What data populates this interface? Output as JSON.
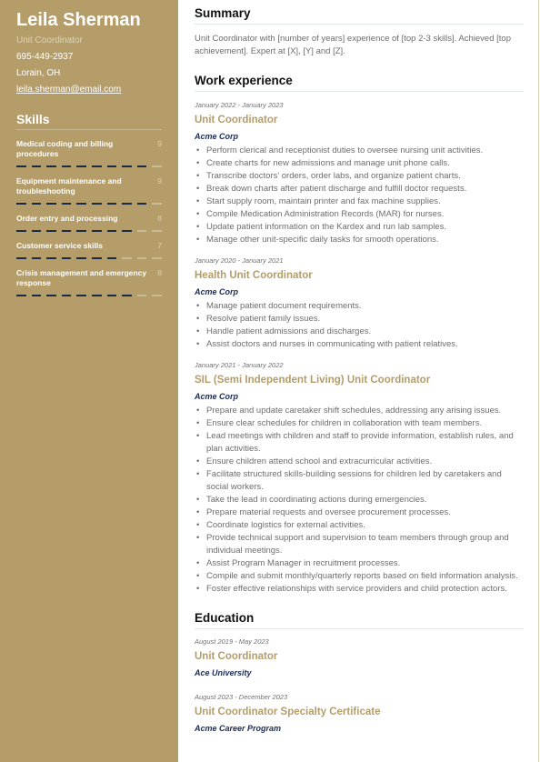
{
  "sidebar": {
    "name": "Leila Sherman",
    "title": "Unit Coordinator",
    "phone": "695-449-2937",
    "location": "Lorain, OH",
    "email": "leila.sherman@email.com",
    "skills_title": "Skills",
    "skills": [
      {
        "name": "Medical coding and billing procedures",
        "score": "9",
        "level": 9,
        "max": 10
      },
      {
        "name": "Equipment maintenance and troubleshooting",
        "score": "9",
        "level": 9,
        "max": 10
      },
      {
        "name": "Order entry and processing",
        "score": "8",
        "level": 8,
        "max": 10
      },
      {
        "name": "Customer service skills",
        "score": "7",
        "level": 7,
        "max": 10
      },
      {
        "name": "Crisis management and emergency response",
        "score": "8",
        "level": 8,
        "max": 10
      }
    ]
  },
  "summary": {
    "title": "Summary",
    "text": "Unit Coordinator with [number of years] experience of [top 2-3 skills]. Achieved [top achievement]. Expert at [X], [Y] and [Z]."
  },
  "experience": {
    "title": "Work experience",
    "jobs": [
      {
        "dates": "January 2022 - January 2023",
        "role": "Unit Coordinator",
        "company": "Acme Corp",
        "bullets": [
          "Perform clerical and receptionist duties to oversee nursing unit activities.",
          "Create charts for new admissions and manage unit phone calls.",
          "Transcribe doctors' orders, order labs, and organize patient charts.",
          "Break down charts after patient discharge and fulfill doctor requests.",
          "Start supply room, maintain printer and fax machine supplies.",
          "Compile Medication Administration Records (MAR) for nurses.",
          "Update patient information on the Kardex and run lab samples.",
          "Manage other unit-specific daily tasks for smooth operations."
        ]
      },
      {
        "dates": "January 2020 - January 2021",
        "role": "Health Unit Coordinator",
        "company": "Acme Corp",
        "bullets": [
          "Manage patient document requirements.",
          "Resolve patient family issues.",
          "Handle patient admissions and discharges.",
          "Assist doctors and nurses in communicating with patient relatives."
        ]
      },
      {
        "dates": "January 2021 - January 2022",
        "role": "SIL (Semi Independent Living) Unit Coordinator",
        "company": "Acme Corp",
        "bullets": [
          "Prepare and update caretaker shift schedules, addressing any arising issues.",
          "Ensure clear schedules for children in collaboration with team members.",
          "Lead meetings with children and staff to provide information, establish rules, and plan activities.",
          "Ensure children attend school and extracurricular activities.",
          "Facilitate structured skills-building sessions for children led by caretakers and social workers.",
          "Take the lead in coordinating actions during emergencies.",
          "Prepare material requests and oversee procurement processes.",
          "Coordinate logistics for external activities.",
          "Provide technical support and supervision to team members through group and individual meetings.",
          "Assist Program Manager in recruitment processes.",
          "Compile and submit monthly/quarterly reports based on field information analysis.",
          "Foster effective relationships with service providers and child protection actors."
        ]
      }
    ]
  },
  "education": {
    "title": "Education",
    "items": [
      {
        "dates": "August 2019 - May 2023",
        "degree": "Unit Coordinator",
        "school": "Ace University"
      },
      {
        "dates": "August 2023 - December 2023",
        "degree": "Unit Coordinator Specialty Certificate",
        "school": "Acme Career Program"
      }
    ]
  },
  "colors": {
    "sidebar_bg": "#b49d69",
    "accent": "#b49d69",
    "company": "#1c2b55",
    "dash_on": "#1c2b45",
    "dash_off": "#cabb95"
  }
}
